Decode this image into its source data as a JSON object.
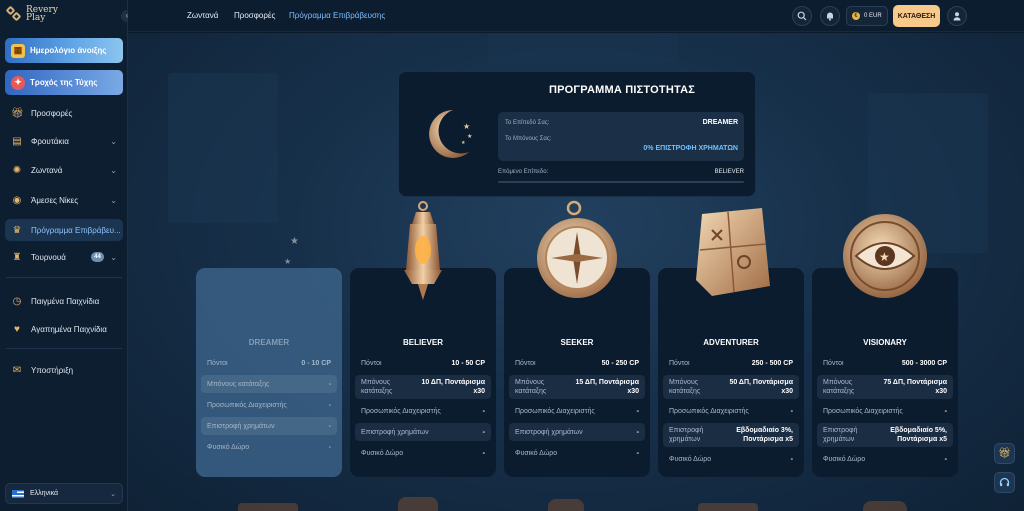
{
  "brand": {
    "line1": "Revery",
    "line2": "Play"
  },
  "sidebar": {
    "promos": [
      {
        "label": "Ημερολόγιο άνοιξης"
      },
      {
        "label": "Τροχός της Τύχης"
      }
    ],
    "items": [
      {
        "label": "Προσφορές"
      },
      {
        "label": "Φρουτάκια"
      },
      {
        "label": "Ζωντανά"
      },
      {
        "label": "Άμεσες Νίκες"
      },
      {
        "label": "Πρόγραμμα Επιβράβευ..."
      },
      {
        "label": "Τουρνουά",
        "badge": "44"
      },
      {
        "label": "Παιγμένα Παιχνίδια"
      },
      {
        "label": "Αγαπημένα Παιχνίδια"
      },
      {
        "label": "Υποστήριξη"
      }
    ],
    "language": "Ελληνικά"
  },
  "header": {
    "nav": [
      "Ζωντανά",
      "Προσφορές",
      "Πρόγραμμα Επιβράβευσης"
    ],
    "balance": "0 EUR",
    "deposit_label": "ΚΑΤΑΘΕΣΗ"
  },
  "loyalty": {
    "title": "ΠΡΟΓΡΑΜΜΑ ΠΙΣΤΟΤΗΤΑΣ",
    "level_label": "Το Επίπεδό Σας:",
    "level_value": "DREAMER",
    "bonus_label": "Το Μπόνους Σας:",
    "bonus_value": "0% ΕΠΙΣΤΡΟΦΗ ΧΡΗΜΑΤΩΝ",
    "next_label": "Επόμενο Επίπεδο:",
    "next_value": "BELIEVER",
    "progress": 0
  },
  "tiers": [
    {
      "name": "DREAMER",
      "rows": [
        {
          "k": "Πόντοι",
          "v": "0 - 10 CP"
        },
        {
          "k": "Μπόνους κατάταξης",
          "v": "-"
        },
        {
          "k": "Προσωπικός Διαχειριστής",
          "v": "-"
        },
        {
          "k": "Επιστροφή χρημάτων",
          "v": "-"
        },
        {
          "k": "Φυσικό Δώρο",
          "v": "-"
        }
      ]
    },
    {
      "name": "BELIEVER",
      "rows": [
        {
          "k": "Πόντοι",
          "v": "10 - 50 CP"
        },
        {
          "k": "Μπόνους κατάταξης",
          "v": "10 ΔΠ, Ποντάρισμα x30"
        },
        {
          "k": "Προσωπικός Διαχειριστής",
          "v": "-"
        },
        {
          "k": "Επιστροφή χρημάτων",
          "v": "-"
        },
        {
          "k": "Φυσικό Δώρο",
          "v": "-"
        }
      ]
    },
    {
      "name": "SEEKER",
      "rows": [
        {
          "k": "Πόντοι",
          "v": "50 - 250 CP"
        },
        {
          "k": "Μπόνους κατάταξης",
          "v": "15 ΔΠ, Ποντάρισμα x30"
        },
        {
          "k": "Προσωπικός Διαχειριστής",
          "v": "-"
        },
        {
          "k": "Επιστροφή χρημάτων",
          "v": "-"
        },
        {
          "k": "Φυσικό Δώρο",
          "v": "-"
        }
      ]
    },
    {
      "name": "ADVENTURER",
      "rows": [
        {
          "k": "Πόντοι",
          "v": "250 - 500 CP"
        },
        {
          "k": "Μπόνους κατάταξης",
          "v": "50 ΔΠ, Ποντάρισμα x30"
        },
        {
          "k": "Προσωπικός Διαχειριστής",
          "v": "-"
        },
        {
          "k": "Επιστροφή χρημάτων",
          "v": "Εβδομαδιαίο 3%, Ποντάρισμα x5"
        },
        {
          "k": "Φυσικό Δώρο",
          "v": "-"
        }
      ]
    },
    {
      "name": "VISIONARY",
      "rows": [
        {
          "k": "Πόντοι",
          "v": "500 - 3000 CP"
        },
        {
          "k": "Μπόνους κατάταξης",
          "v": "75 ΔΠ, Ποντάρισμα x30"
        },
        {
          "k": "Προσωπικός Διαχειριστής",
          "v": "-"
        },
        {
          "k": "Επιστροφή χρημάτων",
          "v": "Εβδομαδιαίο 5%, Ποντάρισμα x5"
        },
        {
          "k": "Φυσικό Δώρο",
          "v": "-"
        }
      ]
    }
  ],
  "colors": {
    "accent": "#7fbfff",
    "deposit": "#f7c98a",
    "bronze": "#d8a878",
    "panel": "#0c1c2f"
  },
  "icons": {
    "gift": "gift-icon",
    "support": "headset-icon"
  }
}
